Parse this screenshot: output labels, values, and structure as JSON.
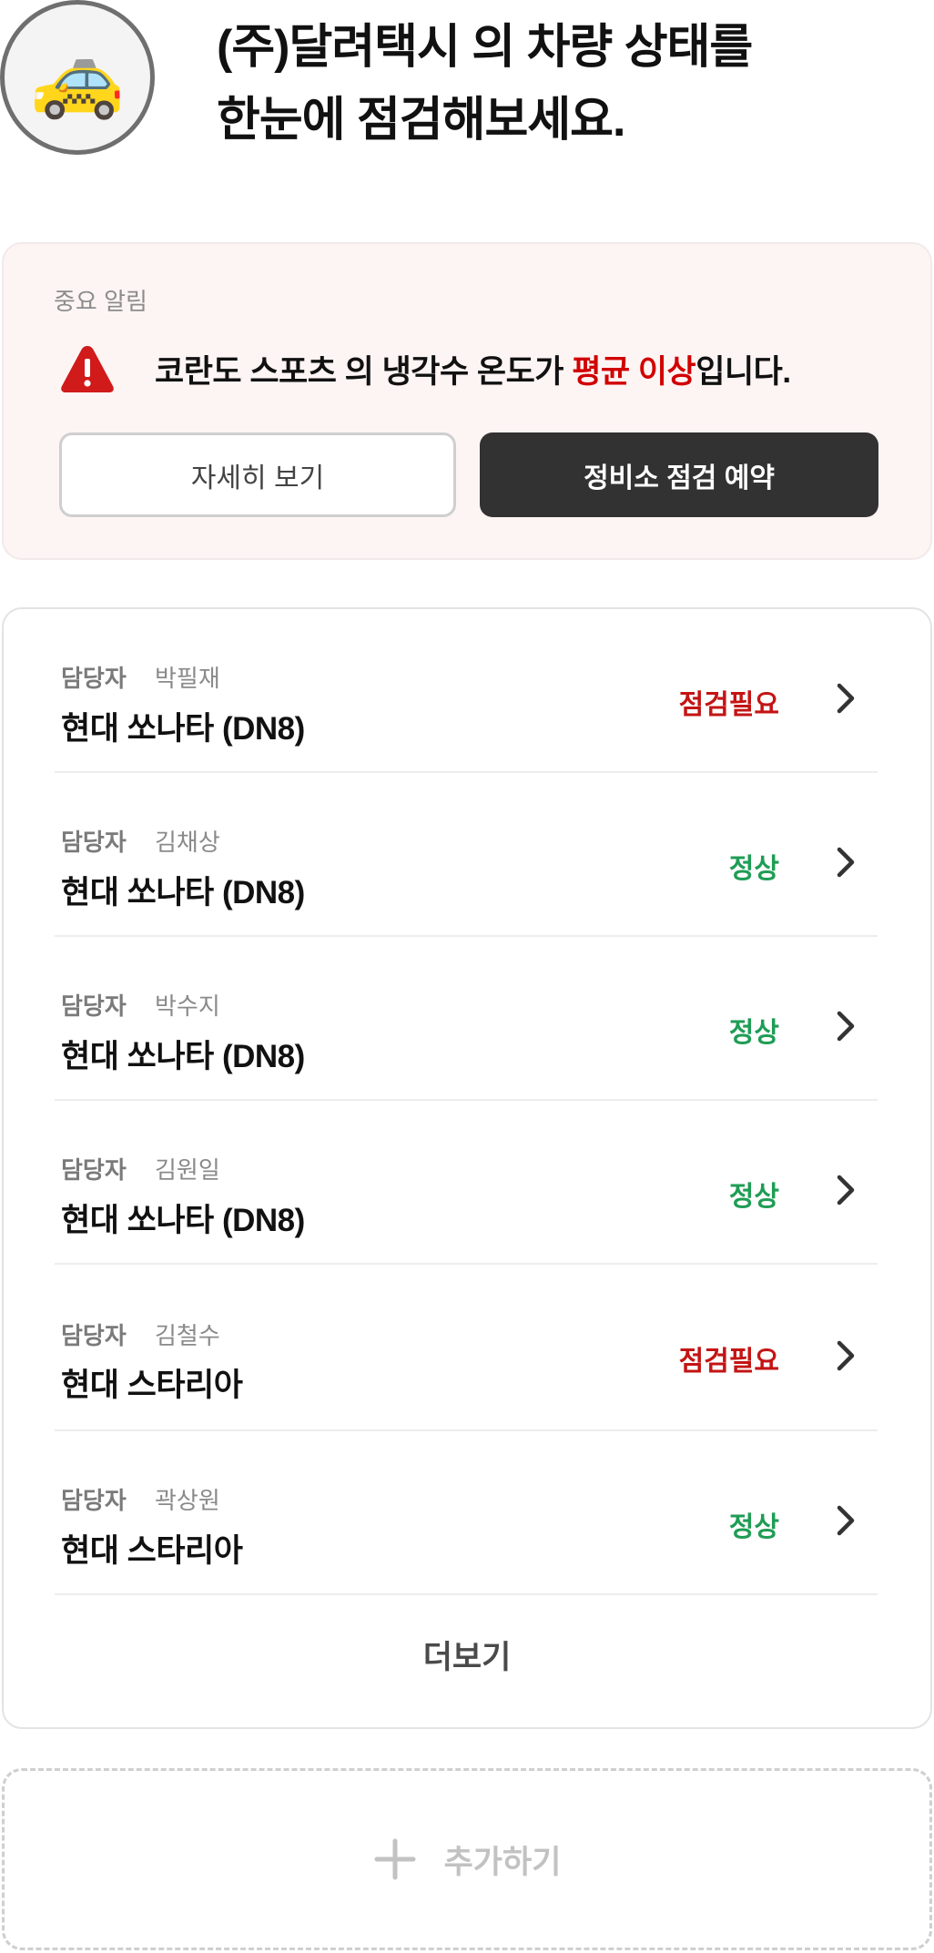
{
  "header": {
    "avatar_emoji": "🚕",
    "headline_line1": "(주)달려택시 의 차량 상태를",
    "headline_line2": "한눈에 점검해보세요."
  },
  "alert": {
    "caption": "중요 알림",
    "icon": "warning-triangle-icon",
    "message_prefix": "코란도 스포츠 의 냉각수 온도가 ",
    "message_highlight": "평균 이상",
    "message_suffix": "입니다.",
    "detail_button": "자세히 보기",
    "reserve_button": "정비소 점검 예약"
  },
  "vehicles": {
    "manager_label": "담당자",
    "items": [
      {
        "manager": "박필재",
        "model": "현대 쏘나타 (DN8)",
        "status": "점검필요",
        "status_type": "warn"
      },
      {
        "manager": "김채상",
        "model": "현대 쏘나타 (DN8)",
        "status": "정상",
        "status_type": "ok"
      },
      {
        "manager": "박수지",
        "model": "현대 쏘나타 (DN8)",
        "status": "정상",
        "status_type": "ok"
      },
      {
        "manager": "김원일",
        "model": "현대 쏘나타 (DN8)",
        "status": "정상",
        "status_type": "ok"
      },
      {
        "manager": "김철수",
        "model": "현대 스타리아",
        "status": "점검필요",
        "status_type": "warn"
      },
      {
        "manager": "곽상원",
        "model": "현대 스타리아",
        "status": "정상",
        "status_type": "ok"
      }
    ],
    "more_label": "더보기"
  },
  "add": {
    "label": "추가하기",
    "icon": "plus-icon"
  },
  "colors": {
    "warn": "#c41414",
    "ok": "#1f9d55",
    "alert_bg": "#fdf5f4",
    "primary_button": "#323232"
  }
}
